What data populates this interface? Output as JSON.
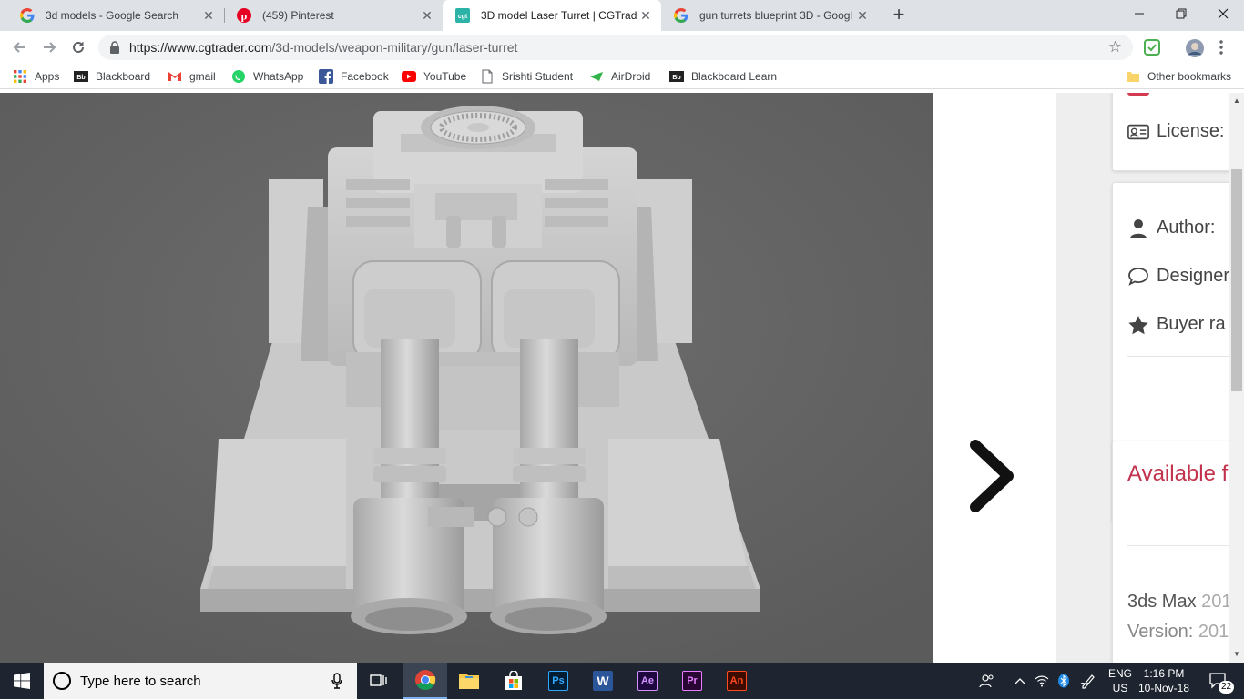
{
  "browser": {
    "tabs": [
      {
        "title": "3d models - Google Search",
        "icon": "google-icon",
        "active": false
      },
      {
        "title": "(459) Pinterest",
        "icon": "pinterest-icon",
        "active": false
      },
      {
        "title": "3D model Laser Turret | CGTrader",
        "icon": "cgtrader-icon",
        "active": true
      },
      {
        "title": "gun turrets blueprint 3D - Googl",
        "icon": "google-icon",
        "active": false
      }
    ],
    "url_host": "https://www.cgtrader.com",
    "url_path": "/3d-models/weapon-military/gun/laser-turret",
    "bookmarks": [
      {
        "label": "Apps",
        "icon": "apps-grid-icon"
      },
      {
        "label": "Blackboard",
        "icon": "blackboard-icon"
      },
      {
        "label": "gmail",
        "icon": "gmail-icon"
      },
      {
        "label": "WhatsApp",
        "icon": "whatsapp-icon"
      },
      {
        "label": "Facebook",
        "icon": "facebook-icon"
      },
      {
        "label": "YouTube",
        "icon": "youtube-icon"
      },
      {
        "label": "Srishti Student",
        "icon": "page-icon"
      },
      {
        "label": "AirDroid",
        "icon": "airdroid-icon"
      },
      {
        "label": "Blackboard Learn",
        "icon": "blackboard-icon"
      }
    ],
    "other_bookmarks": "Other bookmarks"
  },
  "page": {
    "license_label": "License:",
    "author_label": "Author:",
    "designer_label": "Designer",
    "buyer_label": "Buyer ra",
    "available_label": "Available f",
    "software_name": "3ds Max",
    "software_year": "201",
    "version_label": "Version:",
    "version_value": "201",
    "colors": {
      "accent": "#c2334d",
      "viewer_bg": "#616161"
    }
  },
  "taskbar": {
    "search_placeholder": "Type here to search",
    "apps": [
      "task-view-icon",
      "chrome-icon",
      "file-explorer-icon",
      "store-icon",
      "photoshop-icon",
      "word-icon",
      "after-effects-icon",
      "premiere-icon",
      "animate-icon"
    ],
    "app_labels": {
      "ps": "Ps",
      "word": "W",
      "ae": "Ae",
      "pr": "Pr",
      "an": "An"
    },
    "lang_top": "ENG",
    "lang_bottom": "US",
    "time": "1:16 PM",
    "date": "10-Nov-18",
    "notifications": "22"
  }
}
